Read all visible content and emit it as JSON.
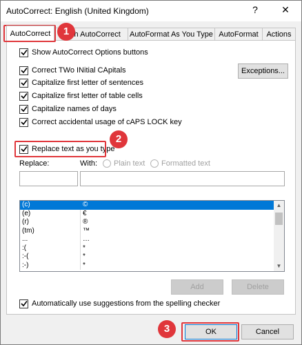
{
  "window": {
    "title": "AutoCorrect: English (United Kingdom)",
    "help_glyph": "?",
    "close_glyph": "✕"
  },
  "tabs": [
    {
      "label": "AutoCorrect"
    },
    {
      "label": "Math AutoCorrect"
    },
    {
      "label": "AutoFormat As You Type"
    },
    {
      "label": "AutoFormat"
    },
    {
      "label": "Actions"
    }
  ],
  "options": {
    "show_buttons": "Show AutoCorrect Options buttons",
    "two_initial": "Correct TWo INitial CApitals",
    "first_sentence": "Capitalize first letter of sentences",
    "first_cell": "Capitalize first letter of table cells",
    "names_days": "Capitalize names of days",
    "caps_lock": "Correct accidental usage of cAPS LOCK key",
    "replace_text": "Replace text as you type",
    "auto_suggest": "Automatically use suggestions from the spelling checker"
  },
  "buttons": {
    "exceptions": "Exceptions...",
    "add": "Add",
    "delete": "Delete",
    "ok": "OK",
    "cancel": "Cancel"
  },
  "replace_section": {
    "replace_label": "Replace:",
    "with_label": "With:",
    "plain_text": "Plain text",
    "formatted_text": "Formatted text",
    "replace_value": "",
    "with_value": ""
  },
  "entries": [
    {
      "from": "(c)",
      "to": "©",
      "selected": true
    },
    {
      "from": "(e)",
      "to": "€"
    },
    {
      "from": "(r)",
      "to": "®"
    },
    {
      "from": "(tm)",
      "to": "™"
    },
    {
      "from": "...",
      "to": "…"
    },
    {
      "from": ":(",
      "to": "*"
    },
    {
      "from": ":-(",
      "to": "*"
    },
    {
      "from": ":-)",
      "to": "*"
    }
  ],
  "badges": [
    "1",
    "2",
    "3"
  ],
  "colors": {
    "highlight": "#e0363b",
    "selection": "#0078d7"
  },
  "icons": {
    "check": "check-icon",
    "scroll_up": "chevron-up-icon",
    "scroll_down": "chevron-down-icon"
  }
}
